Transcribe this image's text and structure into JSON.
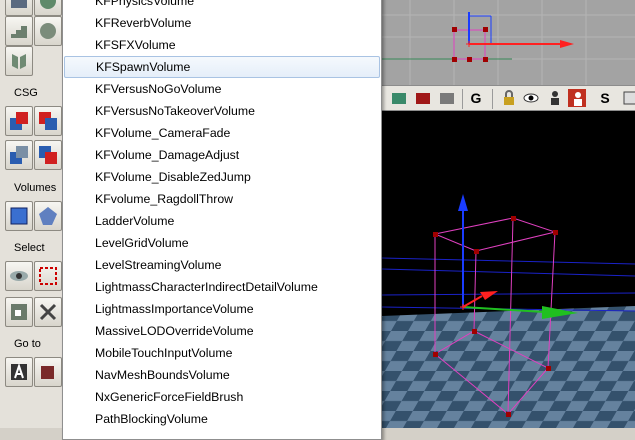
{
  "toolbox": {
    "sections": {
      "csg": "CSG",
      "volumes": "Volumes",
      "select": "Select",
      "goto": "Go to"
    }
  },
  "dropdown": {
    "selected_index": 3,
    "items": [
      "KFPhysicsVolume",
      "KFReverbVolume",
      "KFSFXVolume",
      "KFSpawnVolume",
      "KFVersusNoGoVolume",
      "KFVersusNoTakeoverVolume",
      "KFVolume_CameraFade",
      "KFVolume_DamageAdjust",
      "KFVolume_DisableZedJump",
      "KFvolume_RagdollThrow",
      "LadderVolume",
      "LevelGridVolume",
      "LevelStreamingVolume",
      "LightmassCharacterIndirectDetailVolume",
      "LightmassImportanceVolume",
      "MassiveLODOverrideVolume",
      "MobileTouchInputVolume",
      "NavMeshBoundsVolume",
      "NxGenericForceFieldBrush",
      "PathBlockingVolume"
    ]
  },
  "viewport_toolbar": {
    "label_g": "G",
    "label_s": "S"
  },
  "colors": {
    "selection_border": "#a9c3e3",
    "brush_pink": "#e040c0",
    "vertex_red": "#b00000",
    "axis_blue": "#1a3cff",
    "axis_green": "#20c020",
    "axis_red": "#ff2020"
  }
}
